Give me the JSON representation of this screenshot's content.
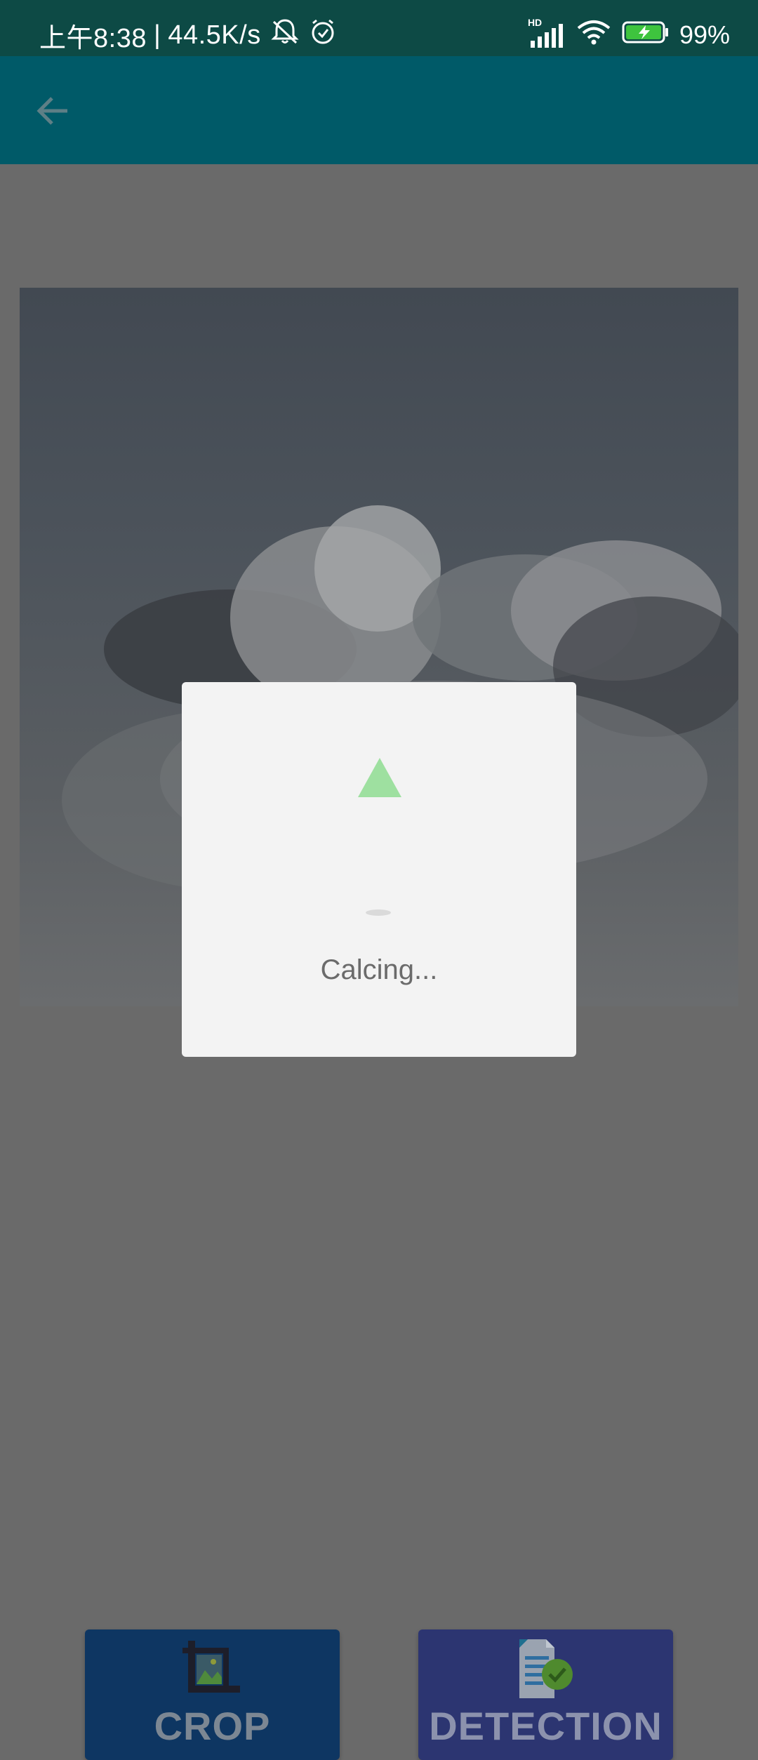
{
  "status_bar": {
    "time": "上午8:38",
    "separator": "|",
    "net_speed": "44.5K/s",
    "network_badge": "HD",
    "battery": "99%"
  },
  "app_bar": {
    "back_icon": "arrow-back-icon"
  },
  "dialog": {
    "message": "Calcing...",
    "spinner_color": "#9ee0a0"
  },
  "actions": {
    "crop_label": "CROP",
    "crop_icon": "crop-image-icon",
    "detection_label": "DETECTION",
    "detection_icon": "document-check-icon"
  },
  "colors": {
    "status_bar": "#0d4a45",
    "app_bar": "#005a68",
    "crop_button": "#0e3662",
    "detection_button": "#2c3571"
  }
}
